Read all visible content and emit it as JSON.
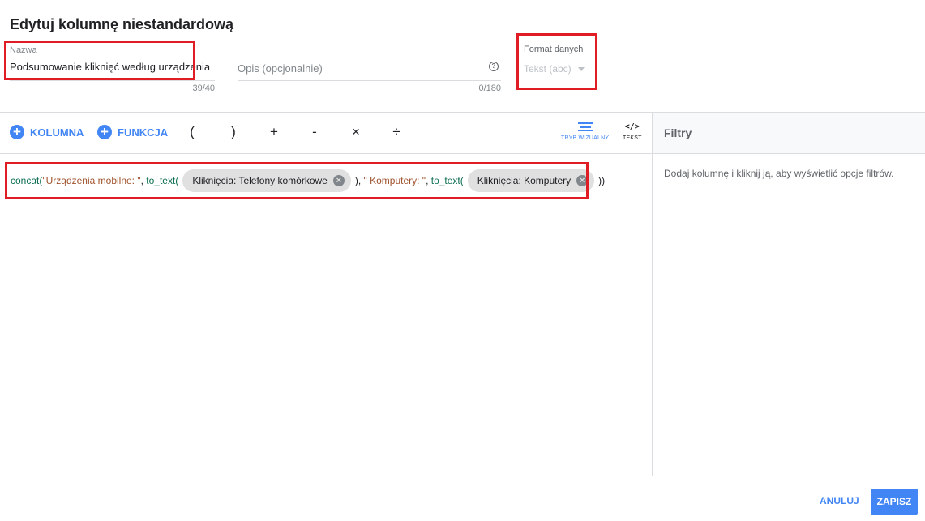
{
  "dialog": {
    "title": "Edytuj kolumnę niestandardową"
  },
  "name_field": {
    "label": "Nazwa",
    "value": "Podsumowanie kliknięć według urządzenia",
    "counter": "39/40"
  },
  "description_field": {
    "placeholder": "Opis (opcjonalnie)",
    "counter": "0/180",
    "help_icon": "help-circle-icon"
  },
  "format_field": {
    "label": "Format danych",
    "value": "Tekst (abc)"
  },
  "toolbar": {
    "column_label": "KOLUMNA",
    "function_label": "FUNKCJA",
    "operators": [
      "(",
      ")",
      "+",
      "-",
      "×",
      "÷"
    ],
    "visual_mode_label": "TRYB WIZUALNY",
    "text_mode_label": "TEKST"
  },
  "formula": {
    "fn1": "concat(",
    "str1": "\"Urządzenia mobilne: \"",
    "sep1": ", ",
    "fn2": "to_text(",
    "chip1": "Kliknięcia: Telefony komórkowe",
    "mid": "), ",
    "str2": "\" Komputery: \"",
    "sep2": ", ",
    "fn3": "to_text(",
    "chip2": "Kliknięcia: Komputery",
    "end": "))"
  },
  "filters": {
    "title": "Filtry",
    "hint": "Dodaj kolumnę i kliknij ją, aby wyświetlić opcje filtrów."
  },
  "footer": {
    "cancel_label": "ANULUJ",
    "save_label": "ZAPISZ"
  },
  "colors": {
    "accent": "#4285f4",
    "highlight": "#e01c24"
  }
}
